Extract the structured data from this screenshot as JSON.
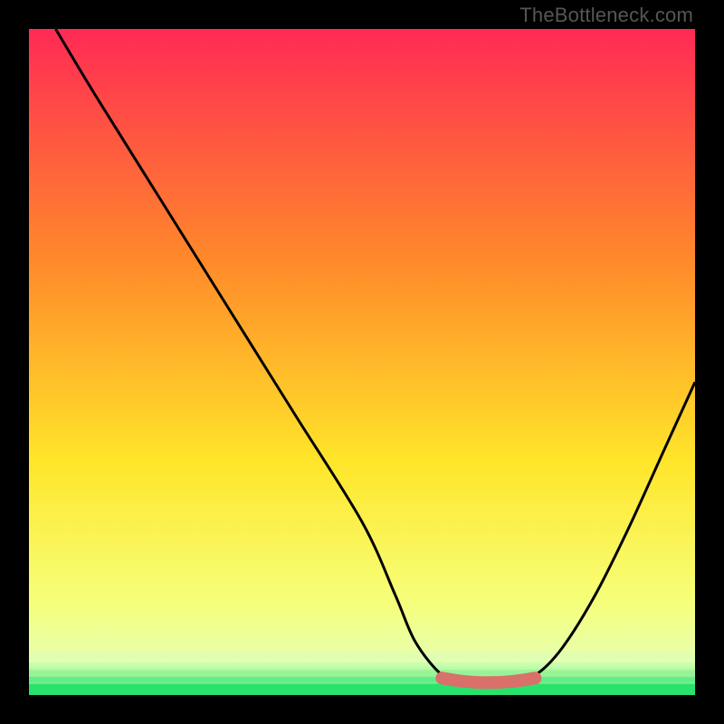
{
  "watermark": {
    "text": "TheBottleneck.com"
  },
  "colors": {
    "gradient_top": "#ff2a55",
    "gradient_mid1": "#ff8a2a",
    "gradient_mid2": "#ffe62a",
    "gradient_low": "#f6ff7a",
    "gradient_green": "#27e36b",
    "curve": "#000000",
    "highlight": "#d9706a",
    "frame_bg": "#000000"
  },
  "chart_data": {
    "type": "line",
    "title": "",
    "xlabel": "",
    "ylabel": "",
    "xlim": [
      0,
      100
    ],
    "ylim": [
      0,
      100
    ],
    "grid": false,
    "legend": false,
    "series": [
      {
        "name": "bottleneck-curve",
        "x": [
          4,
          10,
          20,
          30,
          40,
          50,
          55,
          58,
          62,
          65,
          68,
          72,
          76,
          80,
          85,
          90,
          95,
          100
        ],
        "y": [
          100,
          90,
          74,
          58,
          42,
          26,
          15,
          8,
          3,
          2,
          2,
          2,
          3,
          7,
          15,
          25,
          36,
          47
        ]
      }
    ],
    "highlight_segment": {
      "name": "optimal-range",
      "x_start": 62,
      "x_end": 76,
      "y": 2
    },
    "background_gradient_stops": [
      {
        "pct": 0,
        "color": "#ff2a55"
      },
      {
        "pct": 35,
        "color": "#ff8a2a"
      },
      {
        "pct": 65,
        "color": "#ffe62a"
      },
      {
        "pct": 86,
        "color": "#f6ff7a"
      },
      {
        "pct": 95,
        "color": "#e6ffb0"
      },
      {
        "pct": 100,
        "color": "#27e36b"
      }
    ]
  }
}
